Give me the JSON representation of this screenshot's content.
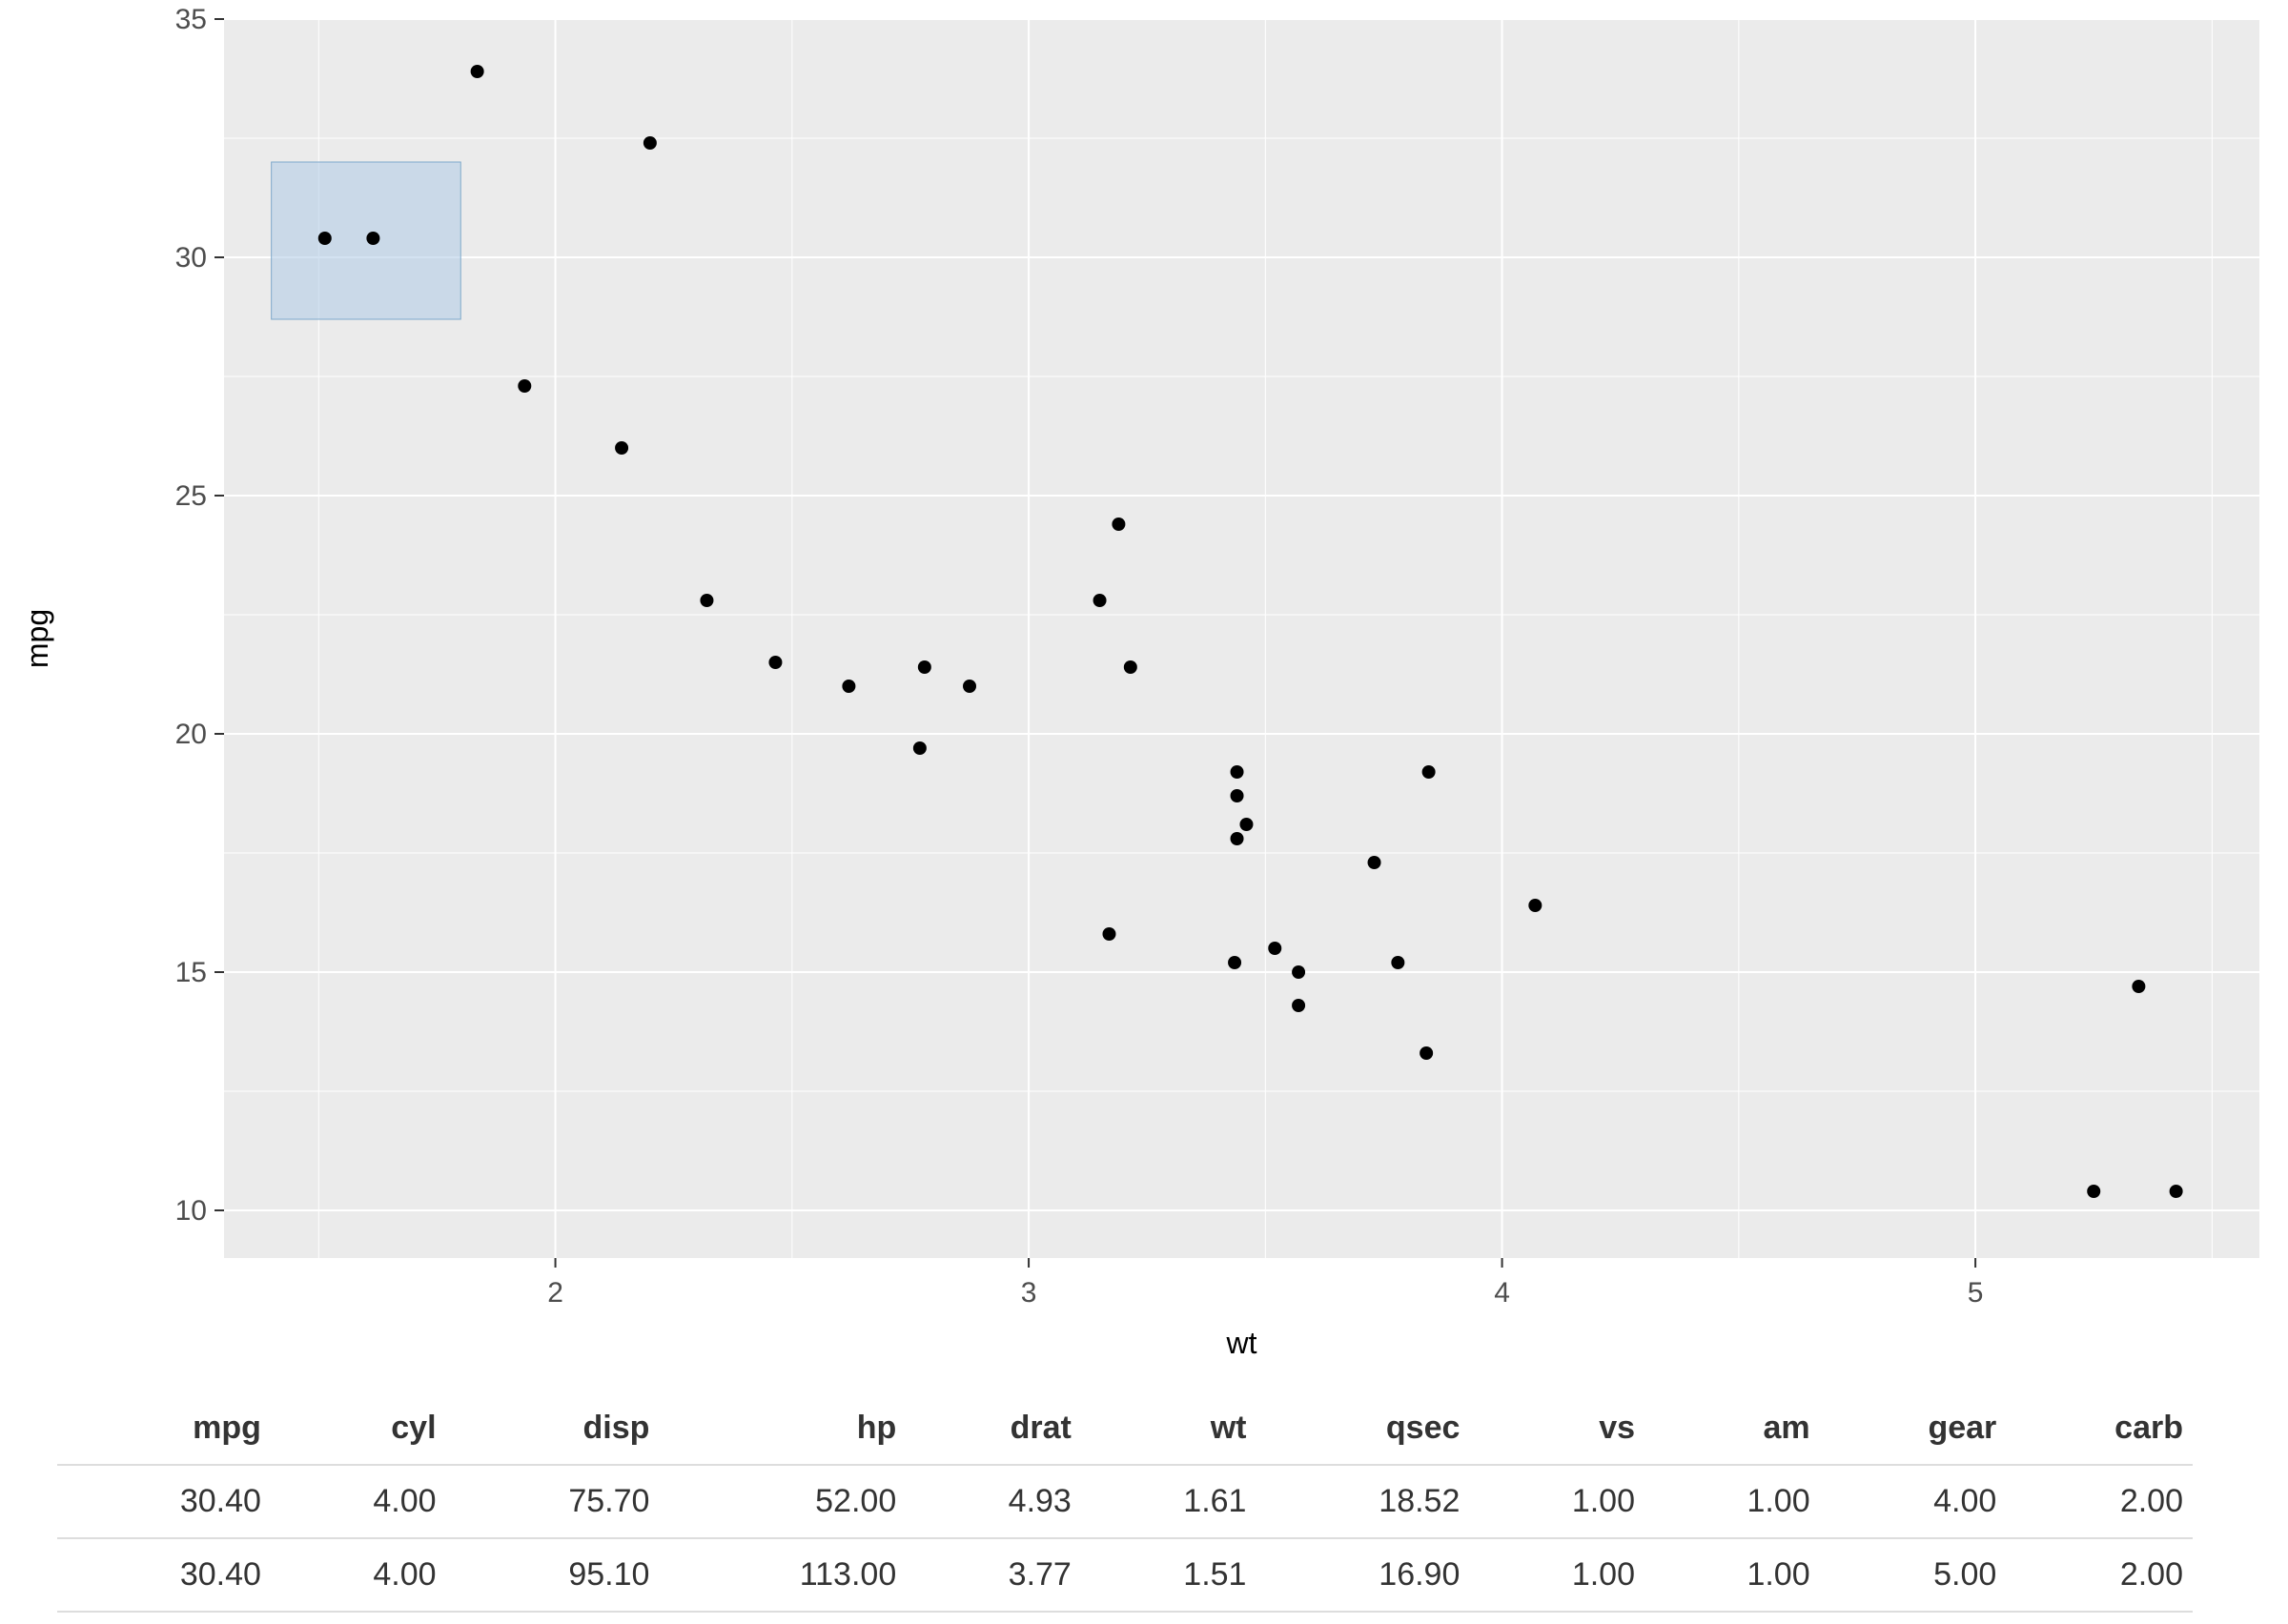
{
  "chart_data": {
    "type": "scatter",
    "xlabel": "wt",
    "ylabel": "mpg",
    "xlim": [
      1.3,
      5.6
    ],
    "ylim": [
      9,
      35
    ],
    "x_ticks": [
      2,
      3,
      4,
      5
    ],
    "y_ticks": [
      10,
      15,
      20,
      25,
      30,
      35
    ],
    "points": [
      {
        "wt": 2.62,
        "mpg": 21.0
      },
      {
        "wt": 2.875,
        "mpg": 21.0
      },
      {
        "wt": 2.32,
        "mpg": 22.8
      },
      {
        "wt": 3.215,
        "mpg": 21.4
      },
      {
        "wt": 3.44,
        "mpg": 18.7
      },
      {
        "wt": 3.46,
        "mpg": 18.1
      },
      {
        "wt": 3.57,
        "mpg": 14.3
      },
      {
        "wt": 3.19,
        "mpg": 24.4
      },
      {
        "wt": 3.15,
        "mpg": 22.8
      },
      {
        "wt": 3.44,
        "mpg": 19.2
      },
      {
        "wt": 3.44,
        "mpg": 17.8
      },
      {
        "wt": 4.07,
        "mpg": 16.4
      },
      {
        "wt": 3.73,
        "mpg": 17.3
      },
      {
        "wt": 3.78,
        "mpg": 15.2
      },
      {
        "wt": 5.25,
        "mpg": 10.4
      },
      {
        "wt": 5.424,
        "mpg": 10.4
      },
      {
        "wt": 5.345,
        "mpg": 14.7
      },
      {
        "wt": 2.2,
        "mpg": 32.4
      },
      {
        "wt": 1.615,
        "mpg": 30.4
      },
      {
        "wt": 1.835,
        "mpg": 33.9
      },
      {
        "wt": 2.465,
        "mpg": 21.5
      },
      {
        "wt": 3.52,
        "mpg": 15.5
      },
      {
        "wt": 3.435,
        "mpg": 15.2
      },
      {
        "wt": 3.84,
        "mpg": 13.3
      },
      {
        "wt": 3.845,
        "mpg": 19.2
      },
      {
        "wt": 1.935,
        "mpg": 27.3
      },
      {
        "wt": 2.14,
        "mpg": 26.0
      },
      {
        "wt": 1.513,
        "mpg": 30.4
      },
      {
        "wt": 3.17,
        "mpg": 15.8
      },
      {
        "wt": 2.77,
        "mpg": 19.7
      },
      {
        "wt": 3.57,
        "mpg": 15.0
      },
      {
        "wt": 2.78,
        "mpg": 21.4
      }
    ],
    "brush": {
      "xmin": 1.4,
      "xmax": 1.8,
      "ymin": 28.7,
      "ymax": 32.0
    }
  },
  "table": {
    "headers": [
      "mpg",
      "cyl",
      "disp",
      "hp",
      "drat",
      "wt",
      "qsec",
      "vs",
      "am",
      "gear",
      "carb"
    ],
    "rows": [
      [
        "30.40",
        "4.00",
        "75.70",
        "52.00",
        "4.93",
        "1.61",
        "18.52",
        "1.00",
        "1.00",
        "4.00",
        "2.00"
      ],
      [
        "30.40",
        "4.00",
        "95.10",
        "113.00",
        "3.77",
        "1.51",
        "16.90",
        "1.00",
        "1.00",
        "5.00",
        "2.00"
      ]
    ]
  }
}
